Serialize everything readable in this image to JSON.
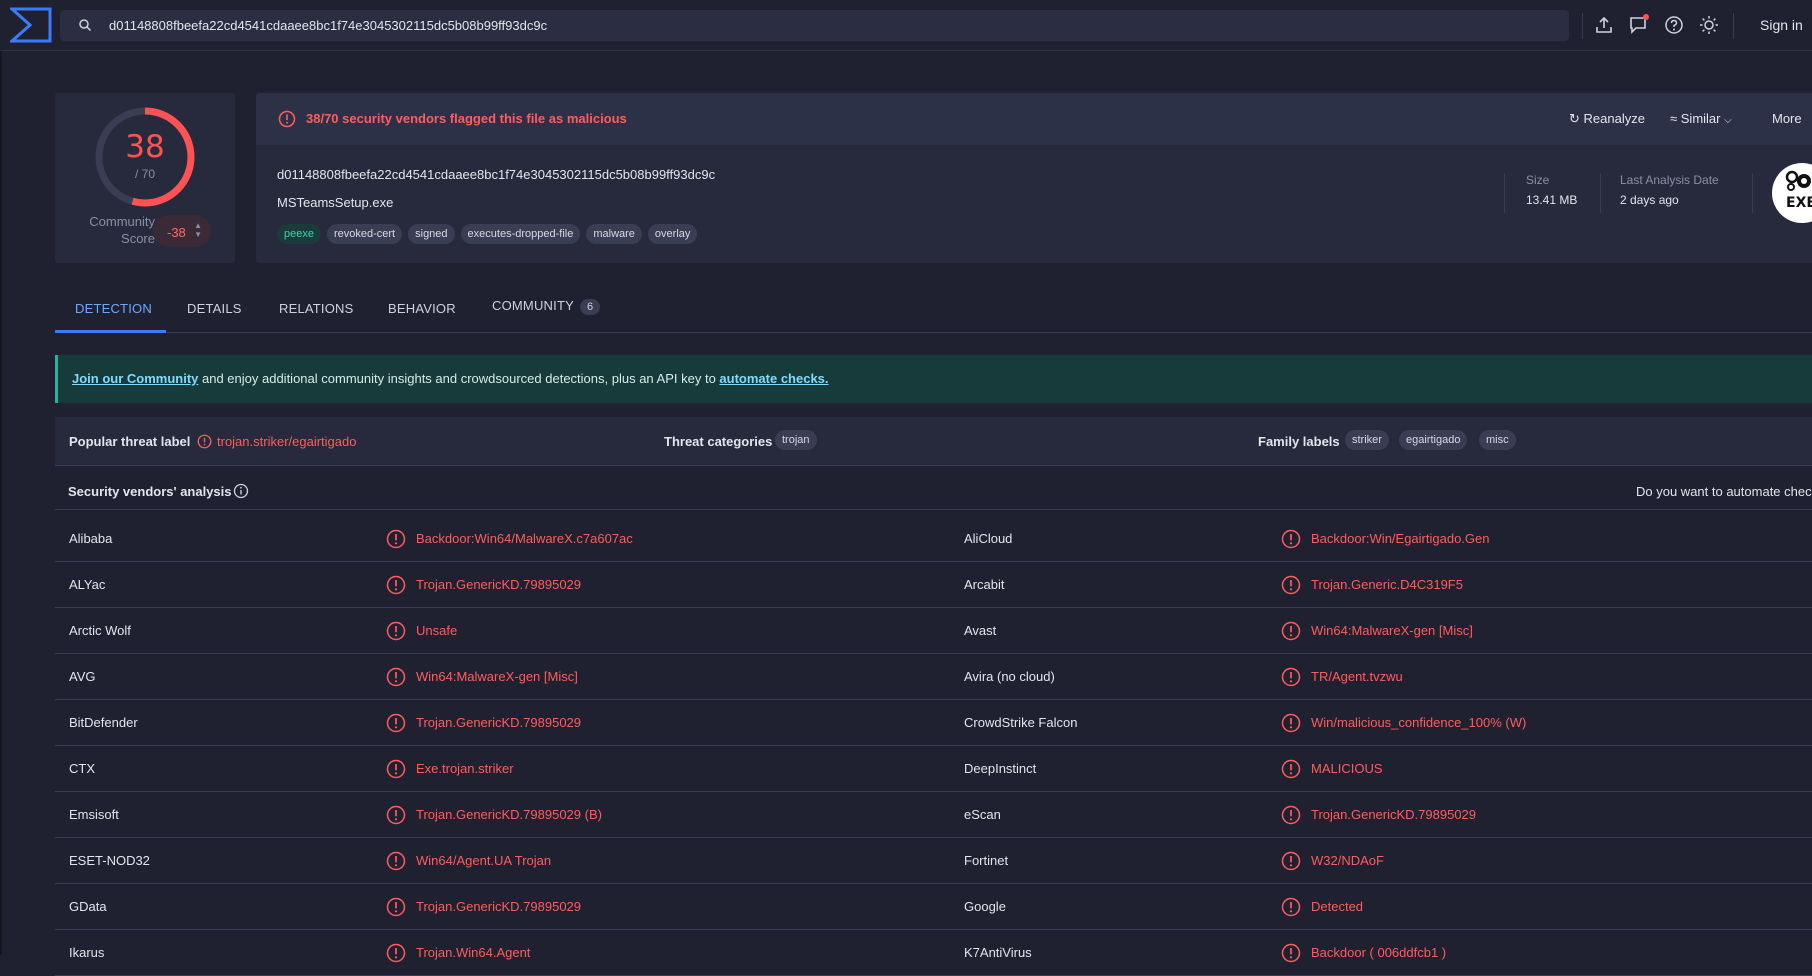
{
  "colors": {
    "accent": "#3c7bff",
    "malicious": "#ff5252",
    "background": "#1f2130",
    "card": "#272a3c"
  },
  "search": {
    "value": "d01148808fbeefa22cd4541cdaaee8bc1f74e3045302115dc5b08b99ff93dc9c"
  },
  "topbar": {
    "sign_in": "Sign in",
    "icons": [
      "upload-icon",
      "chat-notification-icon",
      "help-icon",
      "theme-sun-icon"
    ]
  },
  "score": {
    "detections": "38",
    "total": "/ 70",
    "community_label_1": "Community",
    "community_label_2": "Score",
    "community_value": "-38",
    "detection_ratio": 0.5429
  },
  "summary": {
    "alert": "38/70 security vendors flagged this file as malicious",
    "reanalyze": "Reanalyze",
    "similar": "Similar",
    "more": "More",
    "hash": "d01148808fbeefa22cd4541cdaaee8bc1f74e3045302115dc5b08b99ff93dc9c",
    "filename": "MSTeamsSetup.exe",
    "tags": [
      "peexe",
      "revoked-cert",
      "signed",
      "executes-dropped-file",
      "malware",
      "overlay"
    ],
    "size_label": "Size",
    "size_value": "13.41 MB",
    "date_label": "Last Analysis Date",
    "date_value": "2 days ago",
    "file_type": "EXE"
  },
  "tabs": [
    {
      "label": "DETECTION"
    },
    {
      "label": "DETAILS"
    },
    {
      "label": "RELATIONS"
    },
    {
      "label": "BEHAVIOR"
    },
    {
      "label": "COMMUNITY",
      "badge": "6"
    }
  ],
  "banner": {
    "link1": "Join our Community",
    "middle": " and enjoy additional community insights and crowdsourced detections, plus an API key to ",
    "link2": "automate checks."
  },
  "threat": {
    "popular_label": "Popular threat label",
    "popular_value": "trojan.striker/egairtigado",
    "categories_label": "Threat categories",
    "categories": [
      "trojan"
    ],
    "family_label": "Family labels",
    "families": [
      "striker",
      "egairtigado",
      "misc"
    ]
  },
  "vendors_head": {
    "title": "Security vendors' analysis",
    "right": "Do you want to automate chec"
  },
  "vendors": [
    {
      "l_name": "Alibaba",
      "l_res": "Backdoor:Win64/MalwareX.c7a607ac",
      "r_name": "AliCloud",
      "r_res": "Backdoor:Win/Egairtigado.Gen"
    },
    {
      "l_name": "ALYac",
      "l_res": "Trojan.GenericKD.79895029",
      "r_name": "Arcabit",
      "r_res": "Trojan.Generic.D4C319F5"
    },
    {
      "l_name": "Arctic Wolf",
      "l_res": "Unsafe",
      "r_name": "Avast",
      "r_res": "Win64:MalwareX-gen [Misc]"
    },
    {
      "l_name": "AVG",
      "l_res": "Win64:MalwareX-gen [Misc]",
      "r_name": "Avira (no cloud)",
      "r_res": "TR/Agent.tvzwu"
    },
    {
      "l_name": "BitDefender",
      "l_res": "Trojan.GenericKD.79895029",
      "r_name": "CrowdStrike Falcon",
      "r_res": "Win/malicious_confidence_100% (W)"
    },
    {
      "l_name": "CTX",
      "l_res": "Exe.trojan.striker",
      "r_name": "DeepInstinct",
      "r_res": "MALICIOUS"
    },
    {
      "l_name": "Emsisoft",
      "l_res": "Trojan.GenericKD.79895029 (B)",
      "r_name": "eScan",
      "r_res": "Trojan.GenericKD.79895029"
    },
    {
      "l_name": "ESET-NOD32",
      "l_res": "Win64/Agent.UA Trojan",
      "r_name": "Fortinet",
      "r_res": "W32/NDAoF"
    },
    {
      "l_name": "GData",
      "l_res": "Trojan.GenericKD.79895029",
      "r_name": "Google",
      "r_res": "Detected"
    },
    {
      "l_name": "Ikarus",
      "l_res": "Trojan.Win64.Agent",
      "r_name": "K7AntiVirus",
      "r_res": "Backdoor ( 006ddfcb1 )"
    }
  ]
}
